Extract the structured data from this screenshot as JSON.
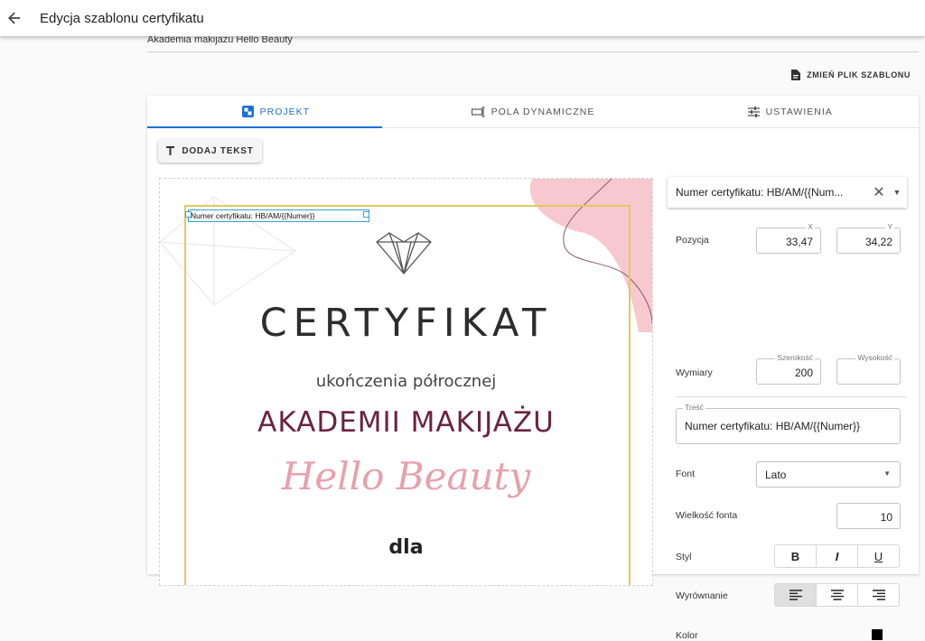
{
  "header": {
    "title": "Edycja szablonu certyfikatu",
    "back_icon": "arrow-left-icon"
  },
  "breadcrumb": "Akademia makijażu Hello Beauty",
  "change_template_label": "ZMIEŃ PLIK SZABLONU",
  "tabs": [
    {
      "label": "PROJEKT",
      "icon": "design-icon",
      "active": true
    },
    {
      "label": "POLA DYNAMICZNE",
      "icon": "dynamic-fields-icon",
      "active": false
    },
    {
      "label": "USTAWIENIA",
      "icon": "settings-sliders-icon",
      "active": false
    }
  ],
  "toolbar": {
    "add_text_label": "DODAJ TEKST"
  },
  "canvas": {
    "selected_text": "Numer certyfikatu: HB/AM/{{Numer}}",
    "cert_title": "CERTYFIKAT",
    "cert_sub": "ukończenia półrocznej",
    "cert_akademii": "AKADEMII MAKIJAŻU",
    "cert_hello": "Hello Beauty",
    "cert_dla": "dla",
    "frame_color": "#e3c95b",
    "accent_pink": "#f7c8cf"
  },
  "panel": {
    "selected_element": "Numer certyfikatu: HB/AM/{{Num...",
    "position_label": "Pozycja",
    "x_label": "X",
    "x_value": "33,47",
    "y_label": "Y",
    "y_value": "34,22",
    "dimensions_label": "Wymiary",
    "width_label": "Szerokość",
    "width_value": "200",
    "height_label": "Wysokość",
    "height_value": "",
    "content_label": "Treść",
    "content_value": "Numer certyfikatu: HB/AM/{{Numer}}",
    "font_label": "Font",
    "font_value": "Lato",
    "font_size_label": "Wielkość fonta",
    "font_size_value": "10",
    "style_label": "Styl",
    "style_bold": "B",
    "style_italic": "I",
    "style_underline": "U",
    "align_label": "Wyrównanie",
    "align_selected": "left",
    "color_label": "Kolor",
    "color_value": "#000000"
  }
}
